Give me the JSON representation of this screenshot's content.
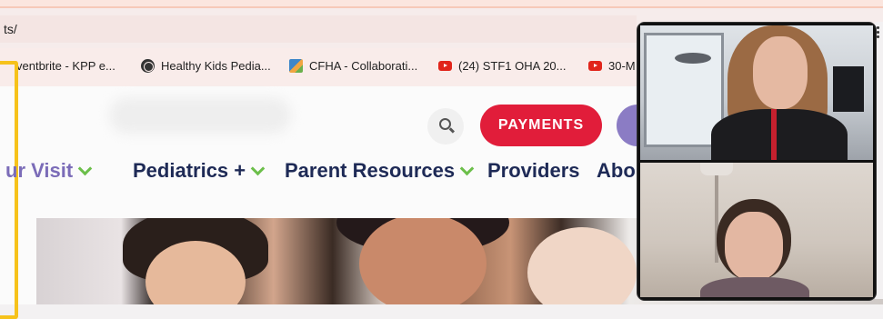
{
  "address_bar": {
    "url_text": "ts/"
  },
  "bookmarks": [
    {
      "label": "ventbrite - KPP e...",
      "icon": "none"
    },
    {
      "label": "Healthy Kids Pedia...",
      "icon": "globe-icon"
    },
    {
      "label": "CFHA - Collaborati...",
      "icon": "cfha-logo-icon"
    },
    {
      "label": "(24) STF1 OHA 20...",
      "icon": "youtube-icon"
    },
    {
      "label": "30-M",
      "icon": "youtube-icon"
    }
  ],
  "site": {
    "payments_label": "PAYMENTS",
    "nav": [
      {
        "label": "ur Visit",
        "has_dropdown": true
      },
      {
        "label": "Pediatrics +",
        "has_dropdown": true
      },
      {
        "label": "Parent Resources",
        "has_dropdown": true
      },
      {
        "label": "Providers",
        "has_dropdown": false
      },
      {
        "label": "Abou",
        "has_dropdown": false
      }
    ]
  },
  "colors": {
    "payments_button": "#e11d3a",
    "nav_text": "#1e2a56",
    "nav_chevron": "#6cbf4a",
    "highlight_box": "#f6c21b",
    "purple_button": "#8b7cc4"
  }
}
